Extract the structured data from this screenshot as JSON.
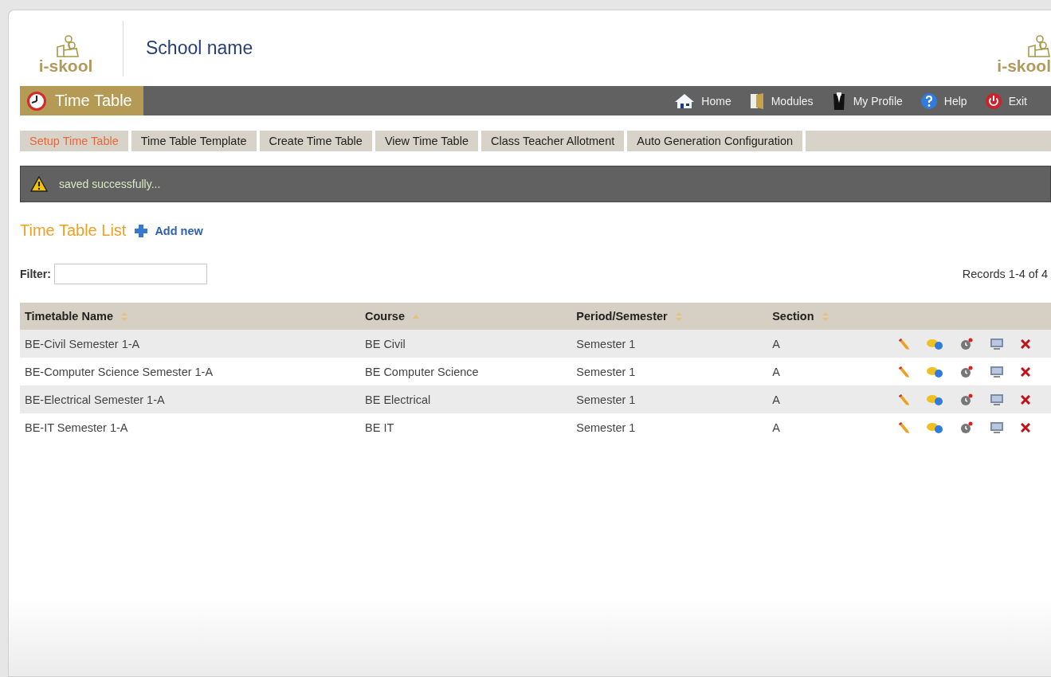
{
  "header": {
    "logo_text": "i-skool",
    "school_name": "School name",
    "right_logo_text": "i-skool"
  },
  "module_bar": {
    "title": "Time Table",
    "links": [
      {
        "label": "Home",
        "kind": "home"
      },
      {
        "label": "Modules",
        "kind": "modules"
      },
      {
        "label": "My Profile",
        "kind": "profile"
      },
      {
        "label": "Help",
        "kind": "help"
      },
      {
        "label": "Exit",
        "kind": "exit"
      }
    ]
  },
  "tabs": [
    {
      "label": "Setup Time Table",
      "selected": true
    },
    {
      "label": "Time Table Template",
      "selected": false
    },
    {
      "label": "Create Time Table",
      "selected": false
    },
    {
      "label": "View Time Table",
      "selected": false
    },
    {
      "label": "Class Teacher Allotment",
      "selected": false
    },
    {
      "label": "Auto Generation Configuration",
      "selected": false
    }
  ],
  "message": "saved successfully...",
  "list": {
    "title": "Time Table List",
    "add_label": "Add new",
    "filter_label": "Filter:",
    "records": "Records 1-4 of 4"
  },
  "table": {
    "columns": [
      {
        "label": "Timetable Name",
        "sorted": false
      },
      {
        "label": "Course",
        "sorted": true
      },
      {
        "label": "Period/Semester",
        "sorted": false
      },
      {
        "label": "Section",
        "sorted": false
      }
    ],
    "rows": [
      [
        "BE-Civil Semester 1-A",
        "BE Civil",
        "Semester 1",
        "A"
      ],
      [
        "BE-Computer Science Semester 1-A",
        "BE Computer Science",
        "Semester 1",
        "A"
      ],
      [
        "BE-Electrical Semester 1-A",
        "BE Electrical",
        "Semester 1",
        "A"
      ],
      [
        "BE-IT Semester 1-A",
        "BE IT",
        "Semester 1",
        "A"
      ]
    ]
  }
}
